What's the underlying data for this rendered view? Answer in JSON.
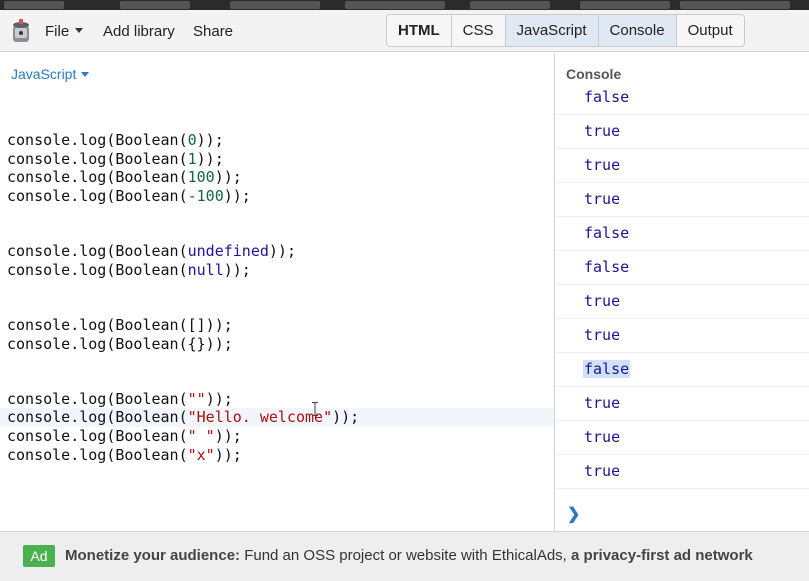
{
  "toolbar": {
    "menu": {
      "file": "File",
      "add_library": "Add library",
      "share": "Share"
    },
    "tabs": [
      "HTML",
      "CSS",
      "JavaScript",
      "Console",
      "Output"
    ]
  },
  "editor": {
    "language": "JavaScript",
    "lines": [
      [
        [
          "console.log(Boolean(",
          "t"
        ],
        [
          "0",
          "n"
        ],
        [
          "));",
          "t"
        ]
      ],
      [
        [
          "console.log(Boolean(",
          "t"
        ],
        [
          "1",
          "n"
        ],
        [
          "));",
          "t"
        ]
      ],
      [
        [
          "console.log(Boolean(",
          "t"
        ],
        [
          "100",
          "n"
        ],
        [
          "));",
          "t"
        ]
      ],
      [
        [
          "console.log(Boolean(",
          "t"
        ],
        [
          "-100",
          "n"
        ],
        [
          "));",
          "t"
        ]
      ],
      [
        [
          "console.log(Boolean(",
          "t"
        ],
        [
          "undefined",
          "k"
        ],
        [
          "));",
          "t"
        ]
      ],
      [
        [
          "console.log(Boolean(",
          "t"
        ],
        [
          "null",
          "k"
        ],
        [
          "));",
          "t"
        ]
      ],
      [
        [
          "console.log(Boolean([]));",
          "t"
        ]
      ],
      [
        [
          "console.log(Boolean({}));",
          "t"
        ]
      ],
      [
        [
          "console.log(Boolean(",
          "t"
        ],
        [
          "\"\"",
          "s"
        ],
        [
          "));",
          "t"
        ]
      ],
      [
        [
          "console.log(Boolean(",
          "t"
        ],
        [
          "\"Hello. welcome\"",
          "s"
        ],
        [
          "));",
          "t"
        ]
      ],
      [
        [
          "console.log(Boolean(",
          "t"
        ],
        [
          "\" \"",
          "s"
        ],
        [
          "));",
          "t"
        ]
      ],
      [
        [
          "console.log(Boolean(",
          "t"
        ],
        [
          "\"x\"",
          "s"
        ],
        [
          "));",
          "t"
        ]
      ]
    ]
  },
  "console": {
    "title": "Console",
    "outputs": [
      "false",
      "true",
      "true",
      "true",
      "false",
      "false",
      "true",
      "true",
      "false",
      "true",
      "true",
      "true"
    ],
    "prompt": "❯"
  },
  "ad": {
    "badge": "Ad",
    "headline": "Monetize your audience:",
    "text": " Fund an OSS project or website with EthicalAds, ",
    "emphasis": "a privacy-first ad network"
  }
}
